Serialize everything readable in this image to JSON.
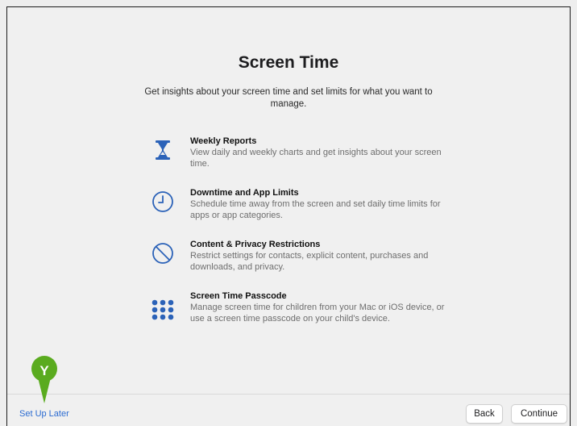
{
  "page": {
    "title": "Screen Time",
    "subtitle": "Get insights about your screen time and set limits for what you want to manage."
  },
  "features": [
    {
      "icon": "hourglass-icon",
      "title": "Weekly Reports",
      "description": "View daily and weekly charts and get insights about your screen time."
    },
    {
      "icon": "clock-icon",
      "title": "Downtime and App Limits",
      "description": "Schedule time away from the screen and set daily time limits for apps or app categories."
    },
    {
      "icon": "prohibited-icon",
      "title": "Content & Privacy Restrictions",
      "description": "Restrict settings for contacts, explicit content, purchases and downloads, and privacy."
    },
    {
      "icon": "passcode-keypad-icon",
      "title": "Screen Time Passcode",
      "description": "Manage screen time for children from your Mac or iOS device, or use a screen time passcode on your child's device."
    }
  ],
  "footer": {
    "setup_later_label": "Set Up Later",
    "back_label": "Back",
    "continue_label": "Continue"
  },
  "callout": {
    "letter": "Y",
    "color": "#5aab1f"
  },
  "colors": {
    "icon_blue": "#2b62b8",
    "link_blue": "#2b6bd1"
  }
}
